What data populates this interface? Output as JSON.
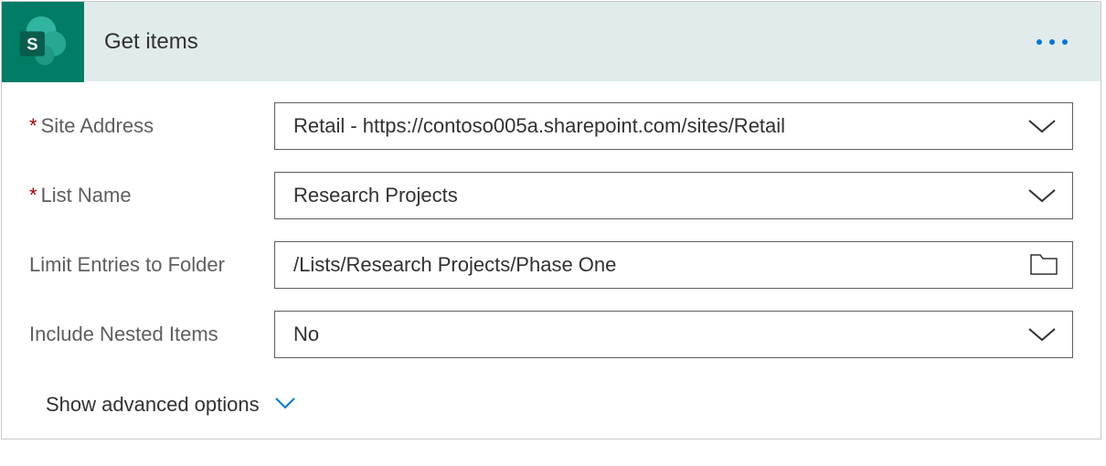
{
  "card": {
    "title": "Get items",
    "connector_icon": "sharepoint-icon"
  },
  "fields": {
    "site_address": {
      "label": "Site Address",
      "required": true,
      "value": "Retail - https://contoso005a.sharepoint.com/sites/Retail"
    },
    "list_name": {
      "label": "List Name",
      "required": true,
      "value": "Research Projects"
    },
    "limit_folder": {
      "label": "Limit Entries to Folder",
      "required": false,
      "value": "/Lists/Research Projects/Phase One"
    },
    "include_nested": {
      "label": "Include Nested Items",
      "required": false,
      "value": "No"
    }
  },
  "advanced": {
    "label": "Show advanced options"
  }
}
